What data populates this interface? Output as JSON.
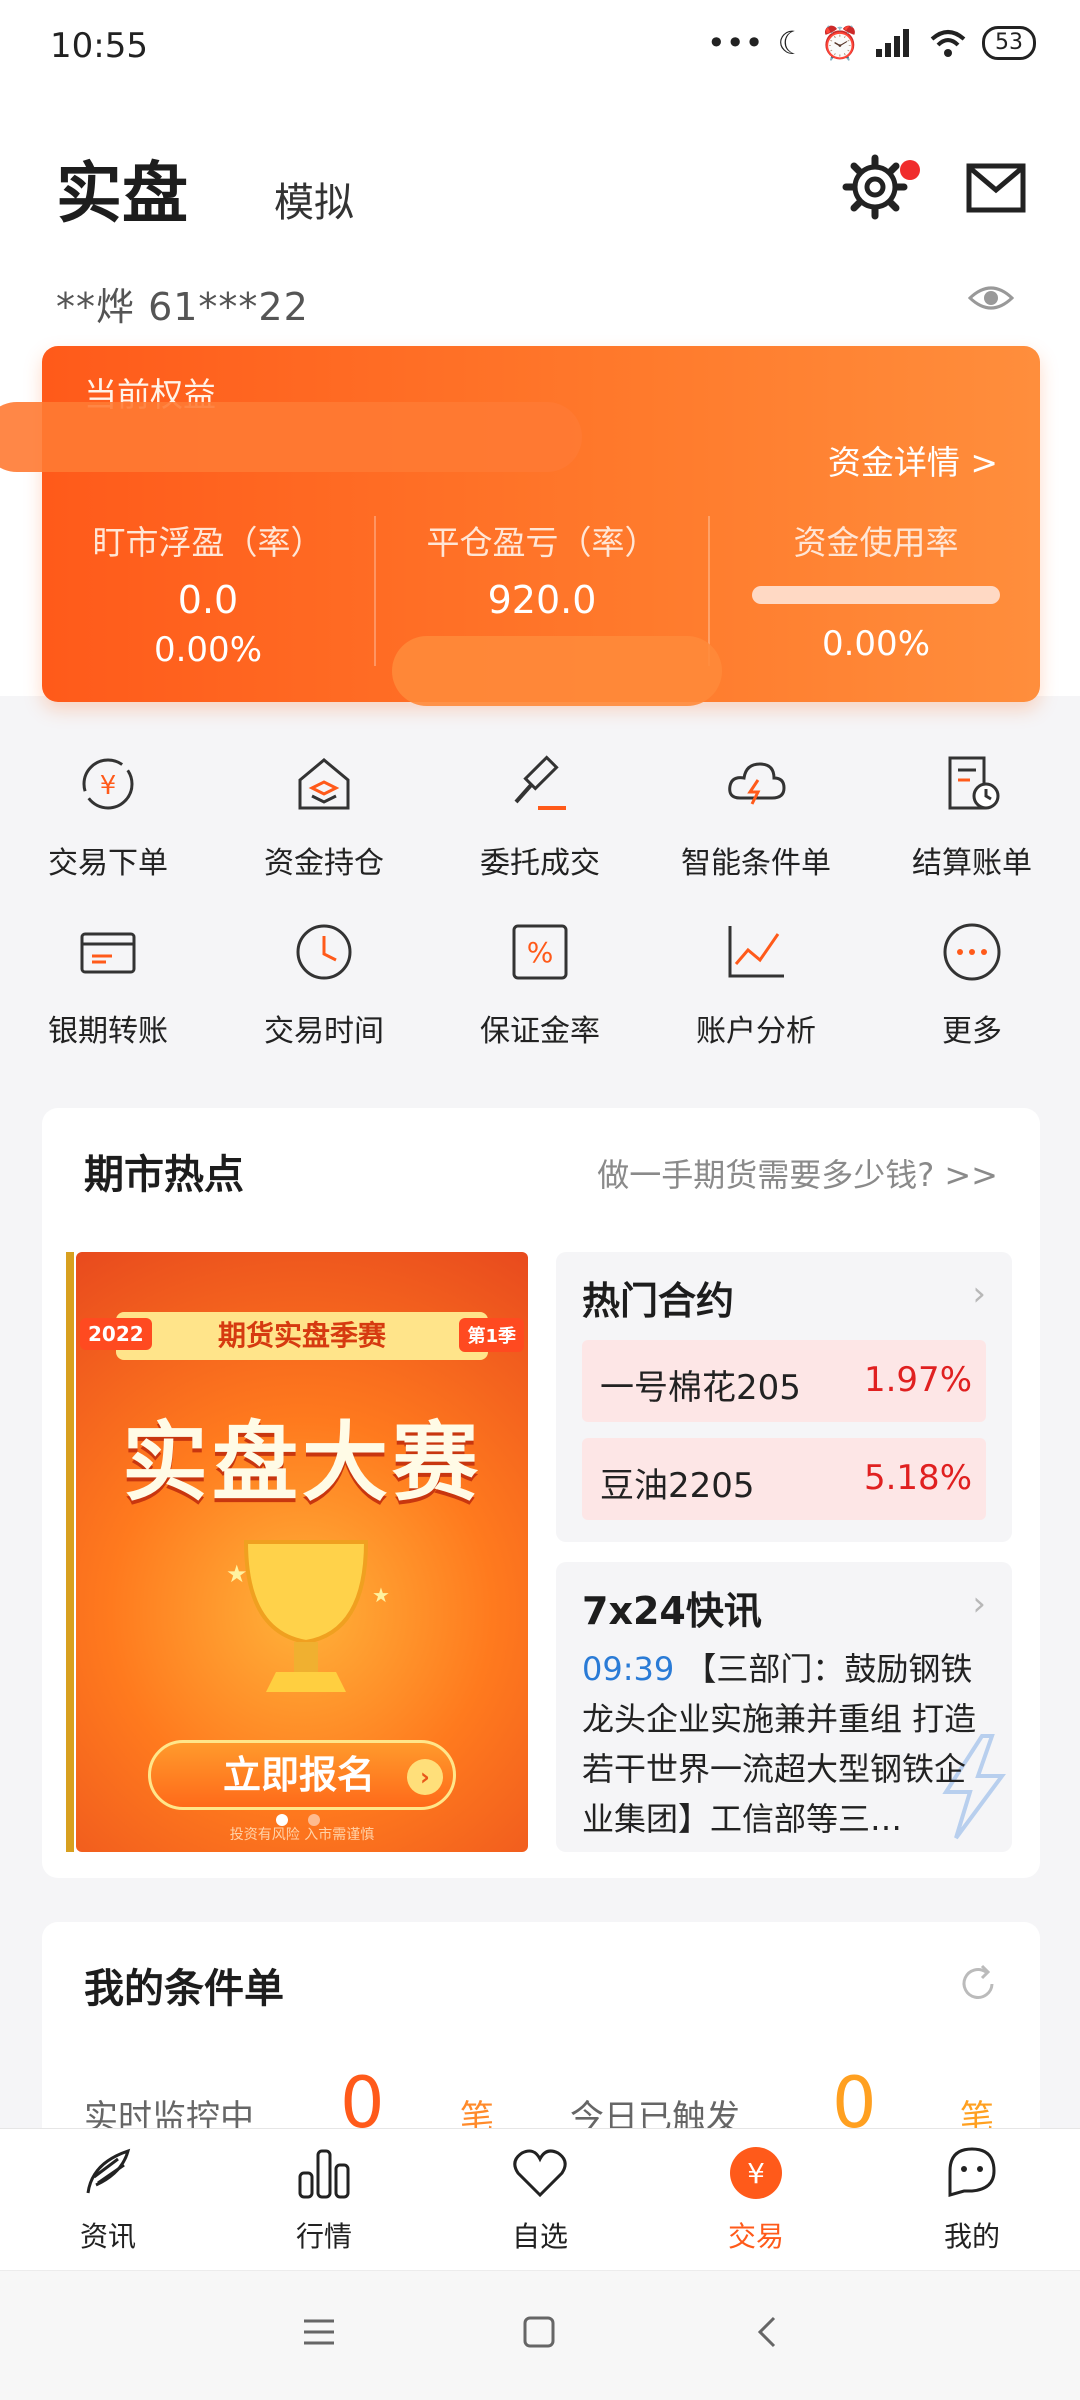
{
  "status_bar": {
    "time": "10:55",
    "battery": "53"
  },
  "header": {
    "tab_real": "实盘",
    "tab_sim": "模拟",
    "account": "**烨  61***22"
  },
  "equity_card": {
    "title": "当前权益",
    "detail_link": "资金详情 >",
    "columns": [
      {
        "label": "盯市浮盈（率）",
        "value": "0.0",
        "pct": "0.00%"
      },
      {
        "label": "平仓盈亏（率）",
        "value": "920.0",
        "pct": ""
      },
      {
        "label": "资金使用率",
        "value": "",
        "pct": "0.00%"
      }
    ],
    "usage_rate": 0.0
  },
  "shortcuts": [
    {
      "label": "交易下单",
      "icon": "yuan-cycle-icon"
    },
    {
      "label": "资金持仓",
      "icon": "house-coins-icon"
    },
    {
      "label": "委托成交",
      "icon": "gavel-icon"
    },
    {
      "label": "智能条件单",
      "icon": "cloud-lightning-icon"
    },
    {
      "label": "结算账单",
      "icon": "bill-clock-icon"
    },
    {
      "label": "银期转账",
      "icon": "card-transfer-icon"
    },
    {
      "label": "交易时间",
      "icon": "clock-icon"
    },
    {
      "label": "保证金率",
      "icon": "percent-icon"
    },
    {
      "label": "账户分析",
      "icon": "line-chart-icon"
    },
    {
      "label": "更多",
      "icon": "more-icon"
    }
  ],
  "hotspots": {
    "title": "期市热点",
    "link": "做一手期货需要多少钱? >>",
    "banner": {
      "year": "2022",
      "ribbon": "期货实盘季赛",
      "season": "第1季",
      "title": "实盘大赛",
      "button": "立即报名",
      "note": "投资有风险 入市需谨慎"
    },
    "hot_contracts": {
      "title": "热门合约",
      "items": [
        {
          "name": "一号棉花205",
          "pct": "1.97%"
        },
        {
          "name": "豆油2205",
          "pct": "5.18%"
        }
      ]
    },
    "news": {
      "title": "7x24快讯",
      "time": "09:39",
      "text": "【三部门：鼓励钢铁龙头企业实施兼并重组 打造若干世界一流超大型钢铁企业集团】工信部等三…"
    }
  },
  "conditions": {
    "title": "我的条件单",
    "monitoring_label": "实时监控中",
    "monitoring_count": "0",
    "triggered_label": "今日已触发",
    "triggered_count": "0",
    "unit": "笔"
  },
  "bottom_nav": [
    {
      "label": "资讯"
    },
    {
      "label": "行情"
    },
    {
      "label": "自选"
    },
    {
      "label": "交易"
    },
    {
      "label": "我的"
    }
  ],
  "colors": {
    "accent": "#ff5a1a",
    "up_red": "#e02020",
    "news_blue": "#2a7bd6"
  }
}
